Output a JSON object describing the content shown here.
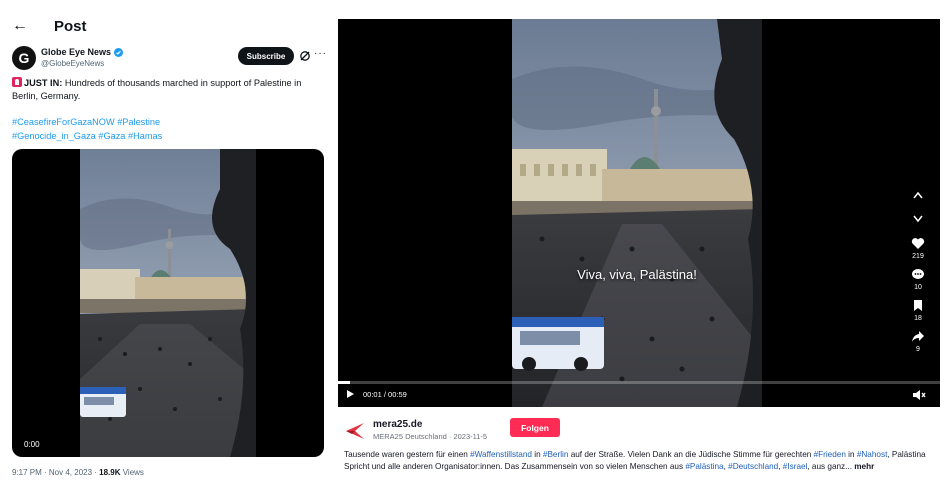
{
  "twitter": {
    "header_title": "Post",
    "author": {
      "name": "Globe Eye News",
      "handle": "@GlobeEyeNews",
      "avatar_letter": "G"
    },
    "subscribe_label": "Subscribe",
    "text": {
      "prefix": "JUST IN:",
      "body": " Hundreds of thousands marched in support of Palestine in Berlin, Germany."
    },
    "hashtags": [
      "#CeasefireForGazaNOW",
      "#Palestine",
      "#Genocide_in_Gaza",
      "#Gaza",
      "#Hamas"
    ],
    "video": {
      "time": "0:00"
    },
    "meta": {
      "timestamp": "9:17 PM · Nov 4, 2023 · ",
      "views": "18.9K",
      "views_label": " Views"
    }
  },
  "tiktok": {
    "caption": "Viva, viva, Palästina!",
    "likes": "219",
    "comments": "10",
    "saves": "18",
    "shares": "9",
    "time": "00:01 / 00:59",
    "progress": 0.02,
    "creator": {
      "name": "mera25.de",
      "sub": "MERA25 Deutschland · 2023-11-5"
    },
    "follow_label": "Folgen",
    "description": {
      "p1": "Tausende waren gestern für einen ",
      "t1": "#Waffenstillstand",
      "p2": " in ",
      "t2": "#Berlin",
      "p3": " auf der Straße. Vielen Dank an die Jüdische Stimme für gerechten ",
      "t3": "#Frieden",
      "p4": " in ",
      "t4": "#Nahost",
      "p5": ", Palästina Spricht und alle anderen Organisator:innen. Das Zusammensein von so vielen Menschen aus ",
      "t5": "#Palästina",
      "p6": ", ",
      "t6": "#Deutschland",
      "p7": ", ",
      "t7": "#Israel",
      "p8": ", aus ganz... ",
      "more": "mehr"
    }
  },
  "colors": {
    "hashtag_blue": "#1d9bf0",
    "follow_red": "#fe2c55",
    "tiktok_tag_blue": "#1d5fb8"
  }
}
